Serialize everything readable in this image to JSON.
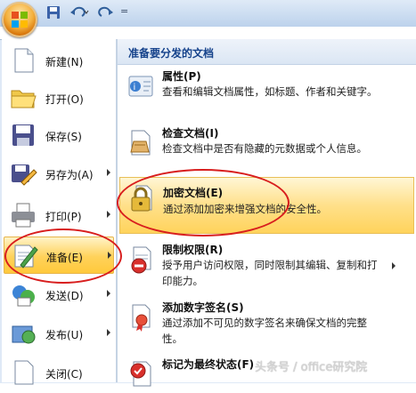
{
  "quick_access": {
    "office_button_icon": "office-logo-icon",
    "save_icon": "save-icon",
    "undo_icon": "undo-icon",
    "redo_icon": "redo-icon",
    "customize_glyph": "="
  },
  "left_menu": {
    "items": [
      {
        "label": "新建(N)",
        "icon": "new-document-icon"
      },
      {
        "label": "打开(O)",
        "icon": "open-folder-icon"
      },
      {
        "label": "保存(S)",
        "icon": "save-disk-icon"
      },
      {
        "label": "另存为(A)",
        "icon": "save-as-icon"
      },
      {
        "label": "打印(P)",
        "icon": "printer-icon"
      },
      {
        "label": "准备(E)",
        "icon": "prepare-icon"
      },
      {
        "label": "发送(D)",
        "icon": "send-icon"
      },
      {
        "label": "发布(U)",
        "icon": "publish-icon"
      },
      {
        "label": "关闭(C)",
        "icon": "close-document-icon"
      }
    ]
  },
  "right_panel": {
    "header": "准备要分发的文档",
    "items": [
      {
        "title": "属性(P)",
        "desc": "查看和编辑文档属性，如标题、作者和关键字。",
        "icon": "properties-icon"
      },
      {
        "title": "检查文档(I)",
        "desc": "检查文档中是否有隐藏的元数据或个人信息。",
        "icon": "inspect-document-icon"
      },
      {
        "title": "加密文档(E)",
        "desc": "通过添加加密来增强文档的安全性。",
        "icon": "encrypt-lock-icon"
      },
      {
        "title": "限制权限(R)",
        "desc": "授予用户访问权限，同时限制其编辑、复制和打印能力。",
        "icon": "restrict-permission-icon"
      },
      {
        "title": "添加数字签名(S)",
        "desc": "通过添加不可见的数字签名来确保文档的完整性。",
        "icon": "digital-signature-icon"
      },
      {
        "title": "标记为最终状态(F)",
        "desc": "",
        "icon": "mark-final-icon"
      }
    ]
  },
  "watermark": "头条号 / office研究院",
  "colors": {
    "highlight": "#ffd35c",
    "annotation_red": "#d81e1e",
    "header_text": "#15428b"
  }
}
